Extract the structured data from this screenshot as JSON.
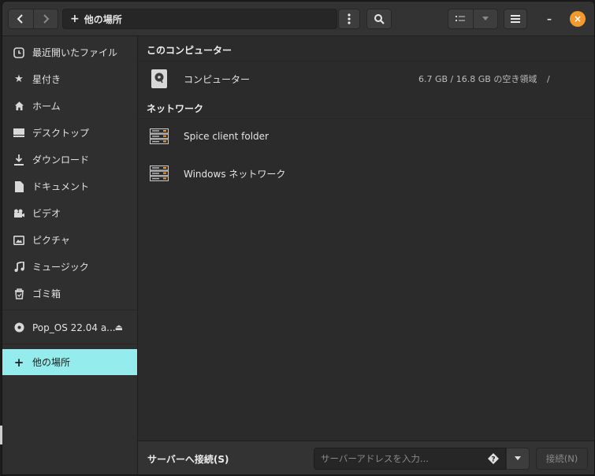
{
  "headerbar": {
    "path_label": "他の場所",
    "back_icon": "chevron-left-icon",
    "forward_icon": "chevron-right-icon",
    "menu_icon": "vertical-dots-icon",
    "search_icon": "search-icon",
    "view_icon": "list-view-icon",
    "view_dropdown_icon": "chevron-down-icon",
    "hamburger_icon": "hamburger-icon",
    "minimize_label": "–",
    "close_label": "×"
  },
  "sidebar": {
    "items": [
      {
        "label": "最近開いたファイル",
        "icon": "clock-icon"
      },
      {
        "label": "星付き",
        "icon": "star-icon"
      },
      {
        "label": "ホーム",
        "icon": "home-icon"
      },
      {
        "label": "デスクトップ",
        "icon": "desktop-icon"
      },
      {
        "label": "ダウンロード",
        "icon": "download-icon"
      },
      {
        "label": "ドキュメント",
        "icon": "document-icon"
      },
      {
        "label": "ビデオ",
        "icon": "video-icon"
      },
      {
        "label": "ピクチャ",
        "icon": "picture-icon"
      },
      {
        "label": "ミュージック",
        "icon": "music-icon"
      },
      {
        "label": "ゴミ箱",
        "icon": "trash-icon"
      }
    ],
    "drive": {
      "label": "Pop_OS 22.04 a...",
      "icon": "disc-icon",
      "eject": "⏏"
    },
    "other": {
      "label": "他の場所",
      "icon": "plus-icon"
    }
  },
  "main": {
    "computer_section": "このコンピューター",
    "computer": {
      "name": "コンピューター",
      "info": "6.7 GB / 16.8 GB の空き領域",
      "path": "/"
    },
    "network_section": "ネットワーク",
    "network_items": [
      {
        "name": "Spice client folder"
      },
      {
        "name": "Windows ネットワーク"
      }
    ]
  },
  "bottombar": {
    "connect_label": "サーバーへ接続(S)",
    "address_placeholder": "サーバーアドレスを入力...",
    "help_icon": "question-icon",
    "connect_button": "接続(N)"
  },
  "colors": {
    "accent": "#94ecec",
    "close": "#f29a2e",
    "background": "#2b2b2b"
  }
}
